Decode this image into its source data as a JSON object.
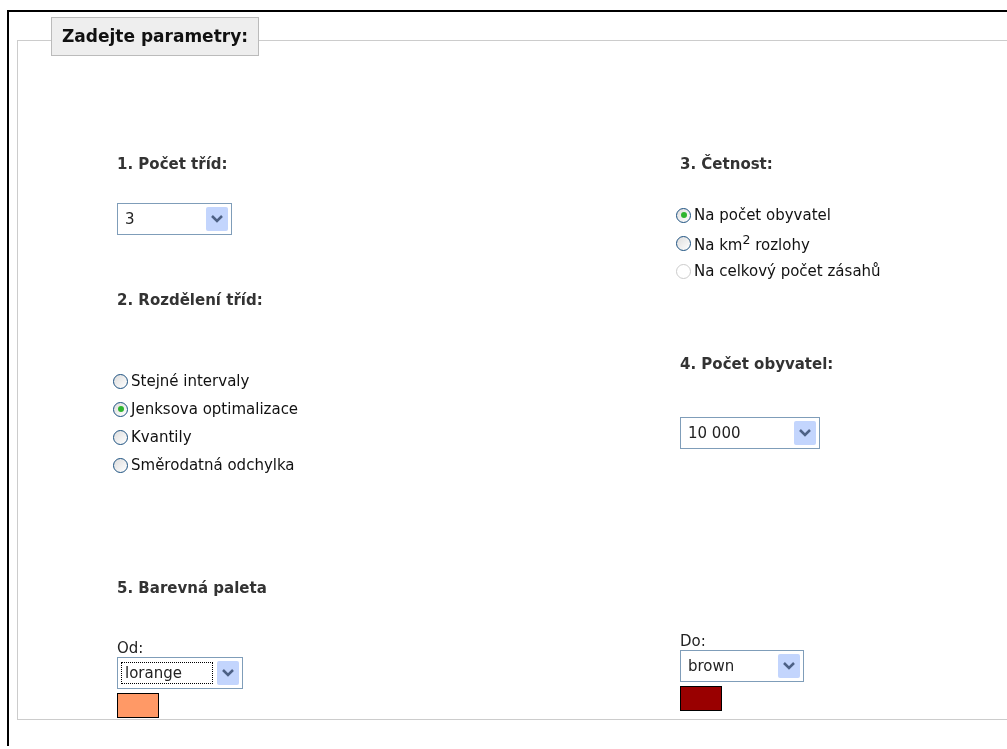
{
  "legend": "Zadejte parametry:",
  "class_count": {
    "heading": "1. Počet tříd:",
    "select": {
      "value": "3"
    }
  },
  "class_division": {
    "heading": "2. Rozdělení tříd:",
    "options": [
      {
        "label": "Stejné intervaly",
        "selected": false,
        "disabled": false
      },
      {
        "label": "Jenksova optimalizace",
        "selected": true,
        "disabled": false
      },
      {
        "label": "Kvantily",
        "selected": false,
        "disabled": false
      },
      {
        "label": "Směrodatná odchylka",
        "selected": false,
        "disabled": false
      }
    ]
  },
  "frequency": {
    "heading": "3. Četnost:",
    "options": [
      {
        "label": "Na počet obyvatel",
        "selected": true,
        "disabled": false
      },
      {
        "label": "Na km$^{2}$ rozlohy",
        "selected": false,
        "disabled": false
      },
      {
        "label": "Na celkový počet zásahů",
        "selected": false,
        "disabled": true
      }
    ]
  },
  "population": {
    "heading": "4. Počet obyvatel:",
    "select": {
      "value": "10 000"
    }
  },
  "palette": {
    "heading": "5. Barevná paleta",
    "ends": [
      {
        "label": "Od:",
        "value": "lorange",
        "focused": true,
        "color": "#ff9966"
      },
      {
        "label": "Do:",
        "value": "brown",
        "focused": false,
        "color": "#990000"
      }
    ]
  }
}
